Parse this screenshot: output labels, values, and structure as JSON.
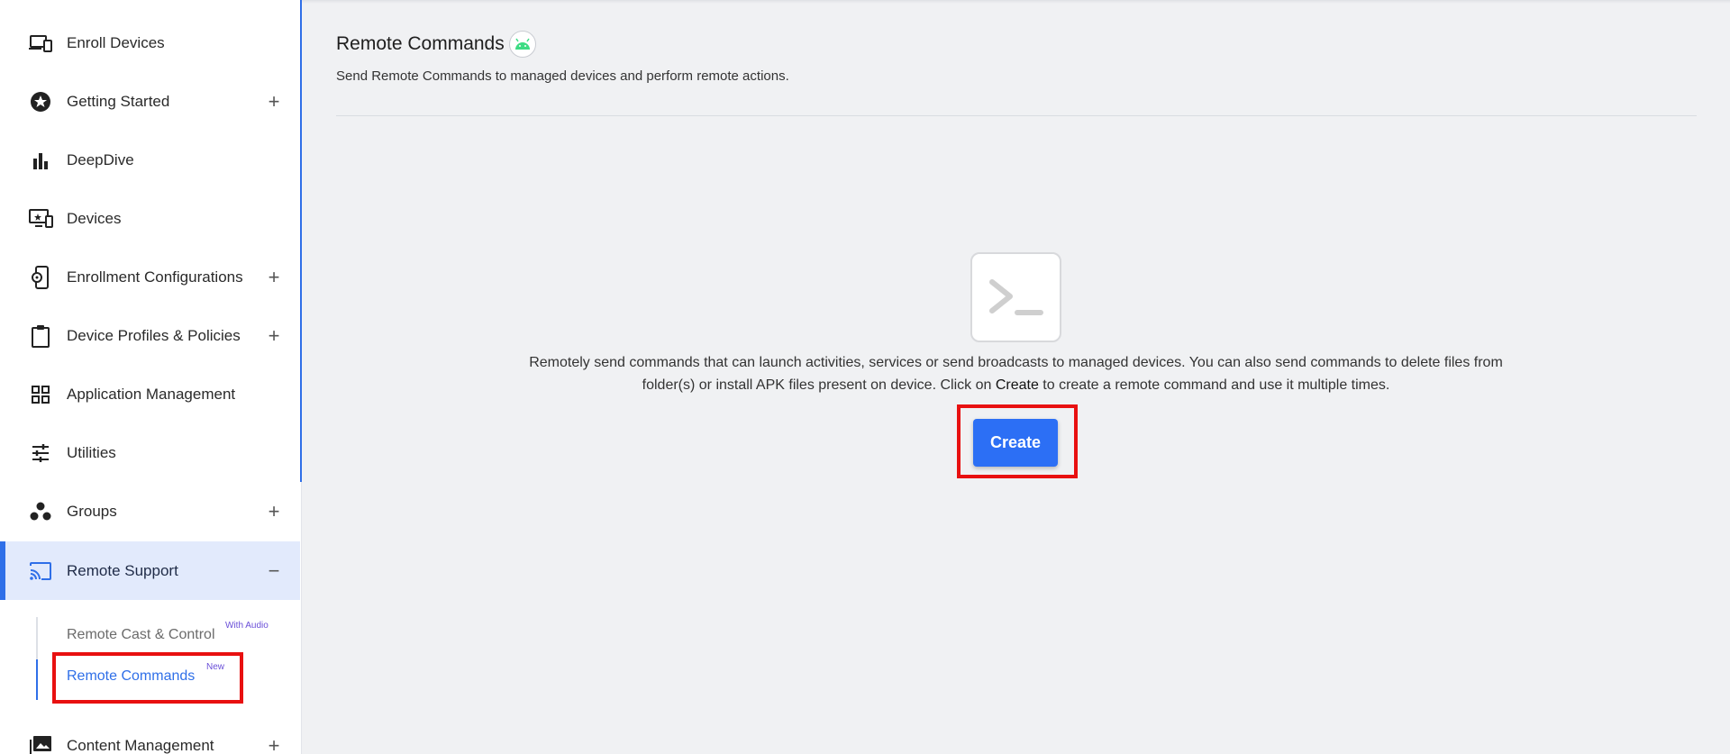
{
  "sidebar": {
    "items": [
      {
        "label": "Enroll Devices",
        "icon": "devices-icon",
        "expandable": false
      },
      {
        "label": "Getting Started",
        "icon": "star-icon",
        "expandable": true
      },
      {
        "label": "DeepDive",
        "icon": "bar-chart-icon",
        "expandable": false
      },
      {
        "label": "Devices",
        "icon": "monitor-icon",
        "expandable": false
      },
      {
        "label": "Enrollment Configurations",
        "icon": "phone-gear-icon",
        "expandable": true
      },
      {
        "label": "Device Profiles & Policies",
        "icon": "clipboard-icon",
        "expandable": true
      },
      {
        "label": "Application Management",
        "icon": "grid-icon",
        "expandable": false
      },
      {
        "label": "Utilities",
        "icon": "sliders-icon",
        "expandable": false
      },
      {
        "label": "Groups",
        "icon": "groups-icon",
        "expandable": true
      },
      {
        "label": "Remote Support",
        "icon": "cast-icon",
        "expandable": true,
        "expanded": true
      },
      {
        "label": "Content Management",
        "icon": "images-icon",
        "expandable": true
      }
    ],
    "plus_symbol": "+",
    "minus_symbol": "−",
    "subitems": [
      {
        "label": "Remote Cast & Control",
        "badge": "With Audio"
      },
      {
        "label": "Remote Commands",
        "badge": "New",
        "active": true
      }
    ]
  },
  "main": {
    "title": "Remote Commands",
    "subtitle": "Send Remote Commands to managed devices and perform remote actions.",
    "description_part1": "Remotely send commands that can launch activities, services or send broadcasts to managed devices. You can also send commands to delete files from folder(s) or install APK files present on device. Click on ",
    "description_strong": "Create",
    "description_part2": " to create a remote command and use it multiple times.",
    "create_label": "Create"
  },
  "colors": {
    "accent": "#2f6fe8",
    "button": "#2c6ff5",
    "highlight": "#e81010",
    "active_bg": "#e2eafc",
    "badge": "#6a4fd8"
  }
}
